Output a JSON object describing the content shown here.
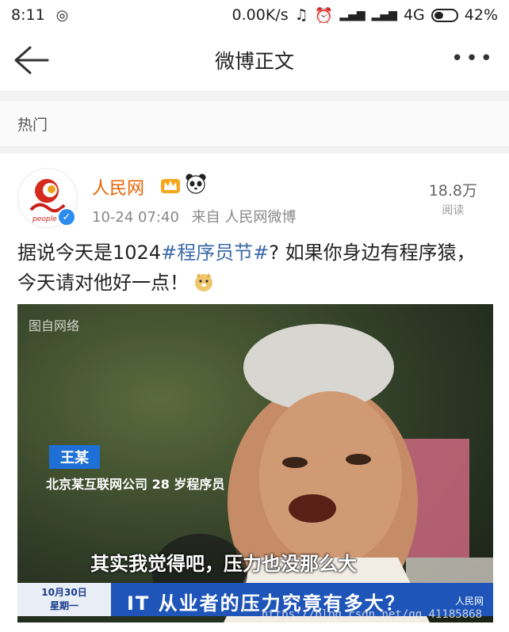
{
  "status_bar": {
    "time": "8:11",
    "network_speed": "0.00K/s",
    "network_type": "4G",
    "battery_percent": "42%",
    "battery_level": 0.42
  },
  "header": {
    "title": "微博正文",
    "more_label": "•••"
  },
  "section": {
    "label": "热门"
  },
  "post": {
    "author": "人民网",
    "timestamp": "10-24 07:40",
    "source": "来自 人民网微博",
    "read_count": "18.8万",
    "read_label": "阅读",
    "text_before": "据说今天是1024",
    "topic": "#程序员节#",
    "text_after": "? 如果你身边有程序猿，今天请对他好一点！",
    "image": {
      "watermark": "图自网络",
      "name_tag": "王某",
      "name_desc": "北京某互联网公司 28 岁程序员",
      "subtitle": "其实我觉得吧，压力也没那么大",
      "date_line1": "10月30日",
      "date_line2": "星期一",
      "headline": "IT 从业者的压力究竟有多大？",
      "channel": "人民网",
      "url_watermark": "https://blog.csdn.net/qq_41185868"
    }
  },
  "colors": {
    "author": "#e86100",
    "topic": "#3b6aa8",
    "verify": "#2d8cf0"
  }
}
